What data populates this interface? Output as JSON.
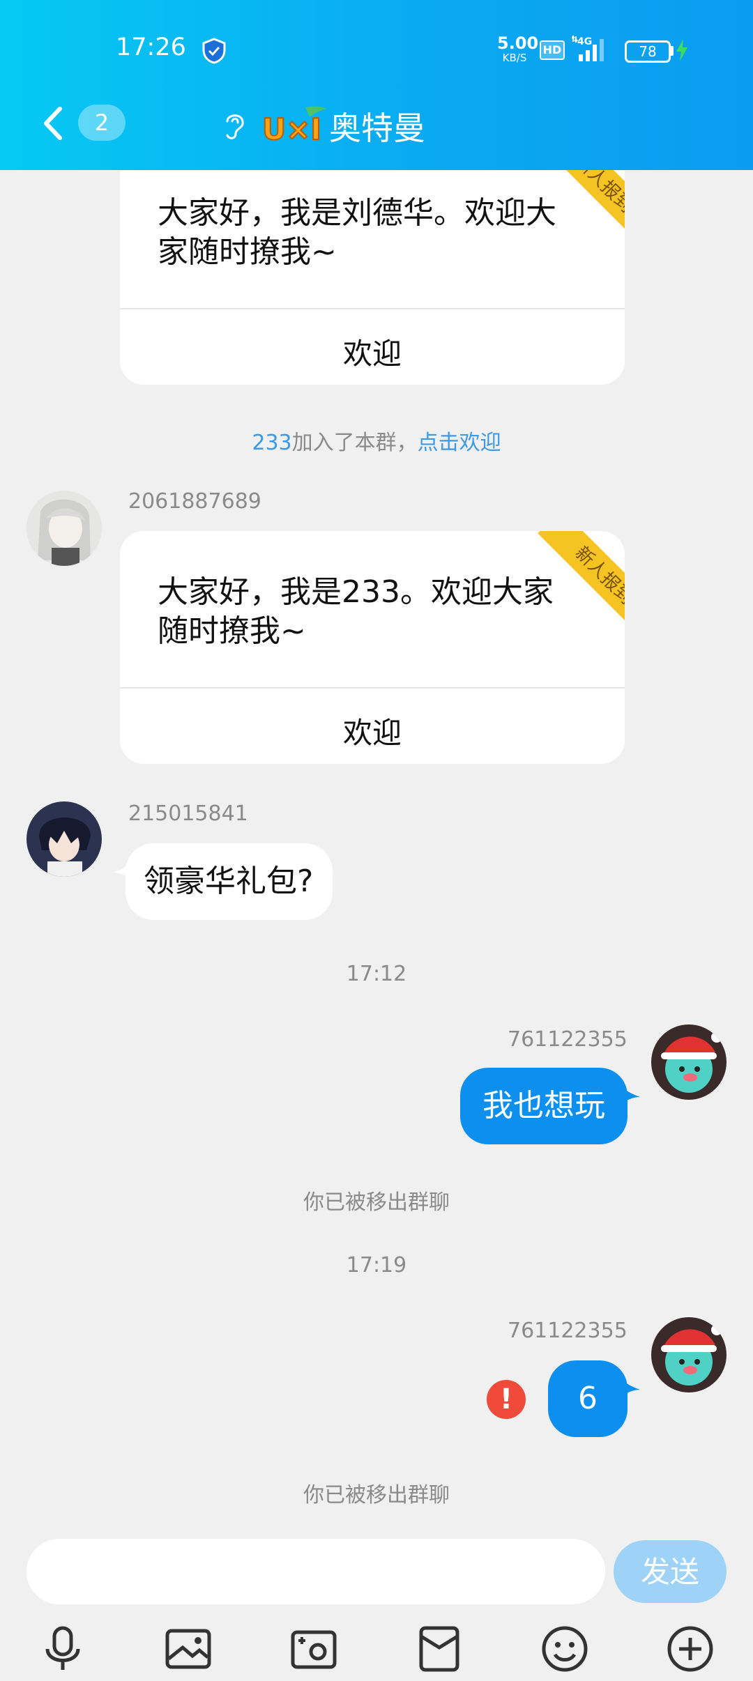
{
  "status_bar": {
    "time": "17:26",
    "net_speed_value": "5.00",
    "net_speed_unit": "KB/S",
    "hd": "HD",
    "network": "4G",
    "battery": "78"
  },
  "header": {
    "unread_count": "2",
    "logo_text": "U×I",
    "title": "奥特曼"
  },
  "messages": {
    "card1": {
      "text": "大家好，我是刘德华。欢迎大家随时撩我~",
      "ribbon": "新人报到",
      "button": "欢迎"
    },
    "join_notice": {
      "user": "233",
      "text": "加入了本群，",
      "link": "点击欢迎"
    },
    "card2": {
      "sender": "2061887689",
      "text": "大家好，我是233。欢迎大家随时撩我~",
      "ribbon": "新人报到",
      "button": "欢迎"
    },
    "msg3": {
      "sender": "215015841",
      "text": "领豪华礼包?"
    },
    "time1": "17:12",
    "msg4": {
      "sender": "761122355",
      "text": "我也想玩"
    },
    "removed1": "你已被移出群聊",
    "time2": "17:19",
    "msg5": {
      "sender": "761122355",
      "text": "6",
      "error_icon": "!"
    },
    "removed2": "你已被移出群聊"
  },
  "composer": {
    "placeholder": "",
    "send_label": "发送"
  },
  "toolbar_icons": [
    "microphone-icon",
    "image-icon",
    "camera-icon",
    "red-packet-icon",
    "emoji-icon",
    "plus-icon"
  ],
  "colors": {
    "header": "#0aaaf2",
    "outgoing_bubble": "#0d8ff0",
    "link": "#3a9ae8",
    "ribbon": "#f5c422",
    "error": "#f04a3a"
  }
}
